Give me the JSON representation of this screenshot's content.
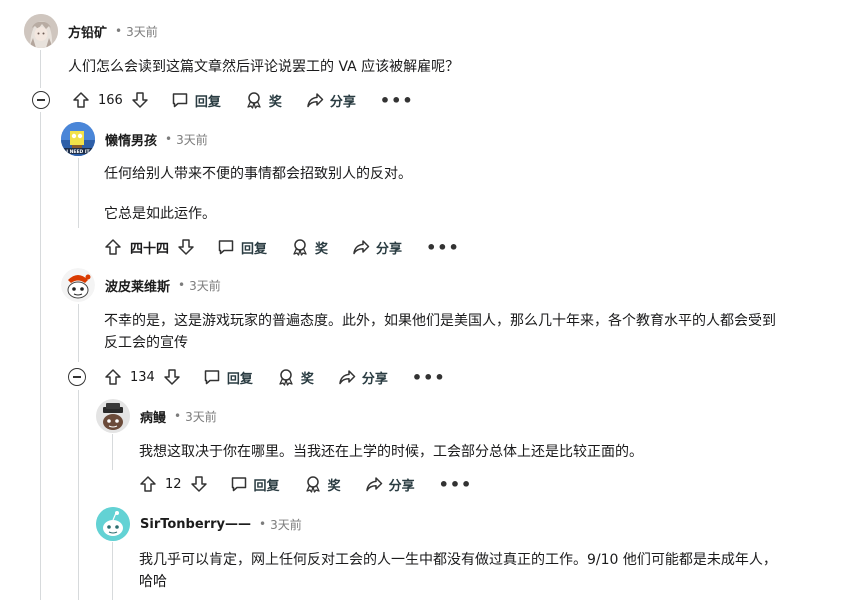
{
  "comments": [
    {
      "author": "方铅矿",
      "time": "3天前",
      "text": [
        "人们怎么会读到这篇文章然后评论说罢工的 VA 应该被解雇呢？"
      ],
      "votes": "166",
      "avatar_icon": "anime-girl-avatar-icon"
    },
    {
      "author": "懒惰男孩",
      "time": "3天前",
      "text": [
        "任何给别人带来不便的事情都会招致别人的反对。",
        "它总是如此运作。"
      ],
      "votes": "四十四",
      "avatar_text": "I NEED IT",
      "avatar_icon": "spongebob-avatar-icon"
    },
    {
      "author": "波皮莱维斯",
      "time": "3天前",
      "text": [
        "不幸的是，这是游戏玩家的普遍态度。此外，如果他们是美国人，那么几十年来，各个教育水平的人都会受到",
        "反工会的宣传"
      ],
      "votes": "134",
      "avatar_icon": "snoo-avatar-icon"
    },
    {
      "author": "病鳗",
      "time": "3天前",
      "text": [
        "我想这取决于你在哪里。当我还在上学的时候，工会部分总体上还是比较正面的。"
      ],
      "votes": "12",
      "avatar_icon": "snoo-hat-avatar-icon"
    },
    {
      "author": "SirTonberry——",
      "time": "3天前",
      "text": [
        "我几乎可以肯定，网上任何反对工会的人一生中都没有做过真正的工作。9/10 他们可能都是未成年人，",
        "哈哈"
      ],
      "avatar_icon": "snoo-teal-avatar-icon"
    }
  ],
  "actions": {
    "reply": "回复",
    "award": "奖",
    "share": "分享",
    "more": "•••"
  },
  "separator": "•"
}
